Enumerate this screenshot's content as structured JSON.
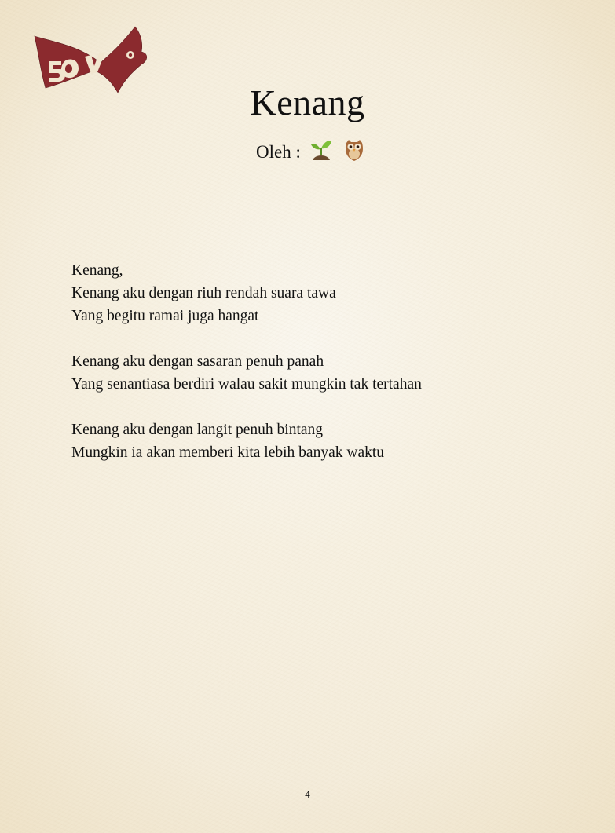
{
  "header": {
    "title": "Kenang",
    "byline_label": "Oleh :",
    "author_icons": [
      "seedling-icon",
      "owl-icon"
    ]
  },
  "poem": {
    "stanzas": [
      [
        "Kenang,",
        "Kenang aku dengan riuh rendah suara tawa",
        "Yang begitu ramai juga hangat"
      ],
      [
        "Kenang aku dengan sasaran penuh panah",
        "Yang senantiasa berdiri walau sakit mungkin tak tertahan"
      ],
      [
        "Kenang aku dengan langit penuh bintang",
        "Mungkin ia akan memberi kita lebih banyak waktu"
      ]
    ]
  },
  "footer": {
    "page_number": "4"
  },
  "colors": {
    "logo": "#8b2a2e",
    "paper": "#f6efe0",
    "text": "#111111"
  }
}
